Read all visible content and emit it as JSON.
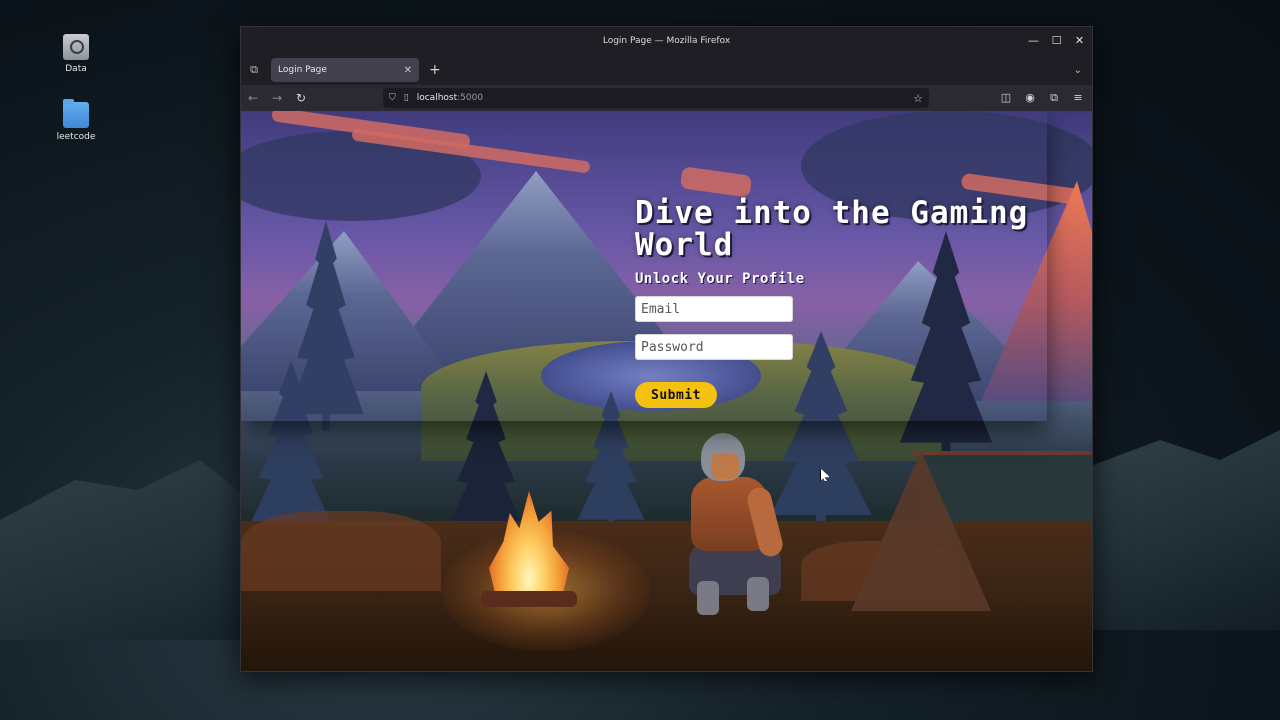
{
  "desktop": {
    "icons": [
      {
        "label": "Data",
        "icon": "drive-icon"
      },
      {
        "label": "leetcode",
        "icon": "folder-icon"
      }
    ]
  },
  "window": {
    "title": "Login Page — Mozilla Firefox",
    "controls": {
      "minimize": "—",
      "maximize": "☐",
      "close": "✕"
    }
  },
  "tabs": [
    {
      "label": "Login Page",
      "active": true
    }
  ],
  "tabbar": {
    "new_tab": "+",
    "overflow": "⌄",
    "side": "⧉"
  },
  "navbar": {
    "back": "←",
    "forward": "→",
    "reload": "↻",
    "url_host": "localhost",
    "url_port": ":5000",
    "bookmark": "☆",
    "right_icons": [
      "pocket-icon",
      "account-icon",
      "extensions-icon",
      "menu-icon"
    ]
  },
  "page": {
    "headline": "Dive into the Gaming World",
    "subheading": "Unlock Your Profile",
    "email_placeholder": "Email",
    "password_placeholder": "Password",
    "submit_label": "Submit"
  },
  "colors": {
    "accent_button": "#f4c20e",
    "browser_chrome": "#2b2a33",
    "tab_active": "#42414d"
  }
}
